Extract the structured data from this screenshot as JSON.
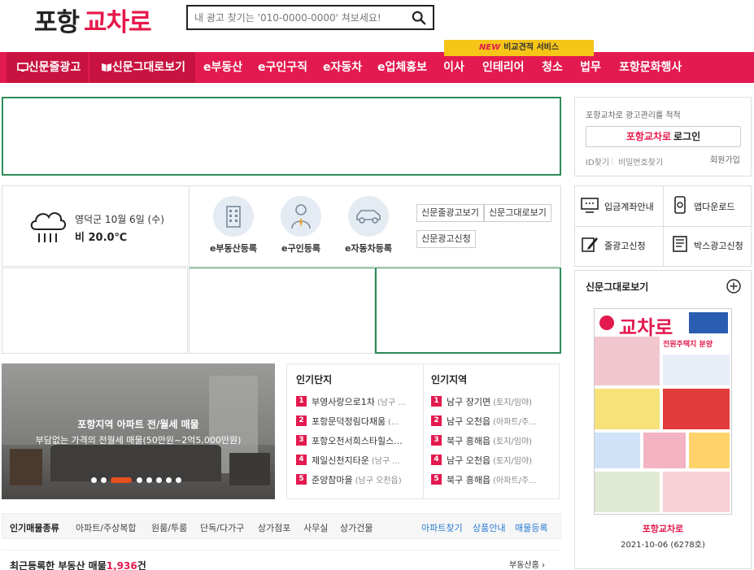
{
  "header": {
    "logo_part1": "포항",
    "logo_part2": "교차로",
    "search_placeholder": "내 광고 찾기는 '010-0000-0000' 쳐보세요!"
  },
  "nav": {
    "badge_new": "NEW",
    "badge_text": "비교견적 서비스",
    "items": [
      "신문줄광고",
      "신문그대로보기",
      "e부동산",
      "e구인구직",
      "e자동차",
      "e업체홍보",
      "이사",
      "인테리어",
      "청소",
      "법무",
      "포항문화행사"
    ]
  },
  "weather": {
    "line1": "영덕군 10월 6일 (수)",
    "line2": "비 20.0℃"
  },
  "register": [
    "e부동산등록",
    "e구인등록",
    "e자동차등록"
  ],
  "quick_buttons": [
    "신문줄광고보기",
    "신문그대로보기",
    "신문광고신청"
  ],
  "login": {
    "title": "포항교차로 광고관리를 척척",
    "button_brand": "포항교차로",
    "button_rest": "로그인",
    "id_find": "ID찾기",
    "pw_find": "비밀번호찾기",
    "join": "회원가입"
  },
  "quick_menu": [
    "입금계좌안내",
    "앱다운로드",
    "줄광고신청",
    "박스광고신청"
  ],
  "newspaper": {
    "title": "신문그대로보기",
    "name": "포항교차로",
    "date": "2021-10-06 (6278호)",
    "masthead": "교차로",
    "headline": "전원주택지 분양"
  },
  "banner": {
    "headline": "포항지역 아파트 전/월세 매물",
    "subline": "부담없는 가격의 전월세 매물(50만원~2억5,000만원)"
  },
  "popular_complex": {
    "title": "인기단지",
    "items": [
      {
        "name": "부영사랑으로1차",
        "sub": "(남구 ..."
      },
      {
        "name": "포항문덕정림다채움",
        "sub": "(..."
      },
      {
        "name": "포항오천서희스타힐스...",
        "sub": ""
      },
      {
        "name": "제일신천지타운",
        "sub": "(남구 ..."
      },
      {
        "name": "준양참마을",
        "sub": "(남구 오천읍)"
      }
    ]
  },
  "popular_region": {
    "title": "인기지역",
    "items": [
      {
        "name": "남구 장기면",
        "sub": "(토지/임야)"
      },
      {
        "name": "남구 오천읍",
        "sub": "(아파트/주..."
      },
      {
        "name": "북구 흥해읍",
        "sub": "(토지/임야)"
      },
      {
        "name": "남구 오천읍",
        "sub": "(토지/임야)"
      },
      {
        "name": "북구 흥해읍",
        "sub": "(아파트/주..."
      }
    ]
  },
  "categories": {
    "title": "인기매물종류",
    "items": [
      "아파트/주상복합",
      "원룸/투룸",
      "단독/다가구",
      "상가점포",
      "사무실",
      "상가건물"
    ],
    "links": [
      "아파트찾기",
      "상품안내",
      "매물등록"
    ]
  },
  "recent": {
    "label": "최근등록한 부동산 매물",
    "count": "1,936",
    "unit": "건",
    "more": "부동산홈 ›"
  }
}
